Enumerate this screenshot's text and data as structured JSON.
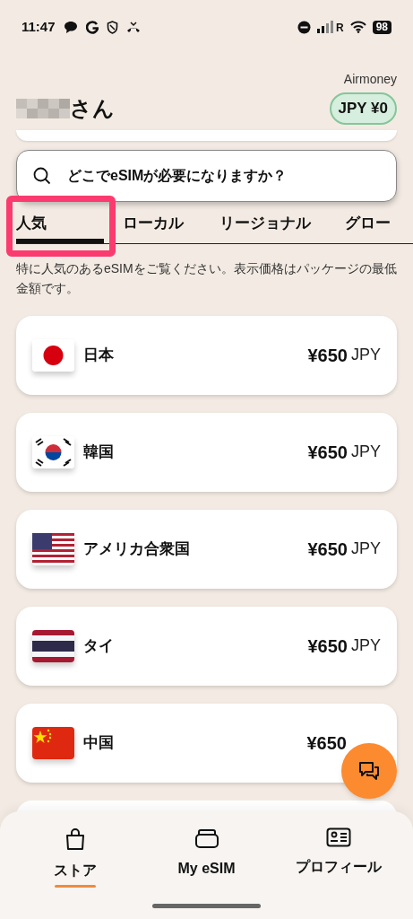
{
  "status_bar": {
    "time": "11:47",
    "carrier_mark": "R",
    "battery": "98"
  },
  "header": {
    "name_suffix": "さん",
    "wallet_label": "Airmoney",
    "wallet_balance": "JPY ¥0"
  },
  "search": {
    "placeholder": "どこでeSIMが必要になりますか？"
  },
  "tabs": [
    {
      "label": "人気",
      "selected": true
    },
    {
      "label": "ローカル",
      "selected": false
    },
    {
      "label": "リージョナル",
      "selected": false
    },
    {
      "label": "グロー",
      "selected": false
    }
  ],
  "description": "特に人気のあるeSIMをご覧ください。表示価格はパッケージの最低金額です。",
  "destinations": [
    {
      "name": "日本",
      "price": "¥650",
      "currency": "JPY"
    },
    {
      "name": "韓国",
      "price": "¥650",
      "currency": "JPY"
    },
    {
      "name": "アメリカ合衆国",
      "price": "¥650",
      "currency": "JPY"
    },
    {
      "name": "タイ",
      "price": "¥650",
      "currency": "JPY"
    },
    {
      "name": "中国",
      "price": "¥650"
    }
  ],
  "bottom_nav": [
    {
      "label": "ストア",
      "selected": true
    },
    {
      "label": "My eSIM",
      "selected": false
    },
    {
      "label": "プロフィール",
      "selected": false
    }
  ]
}
